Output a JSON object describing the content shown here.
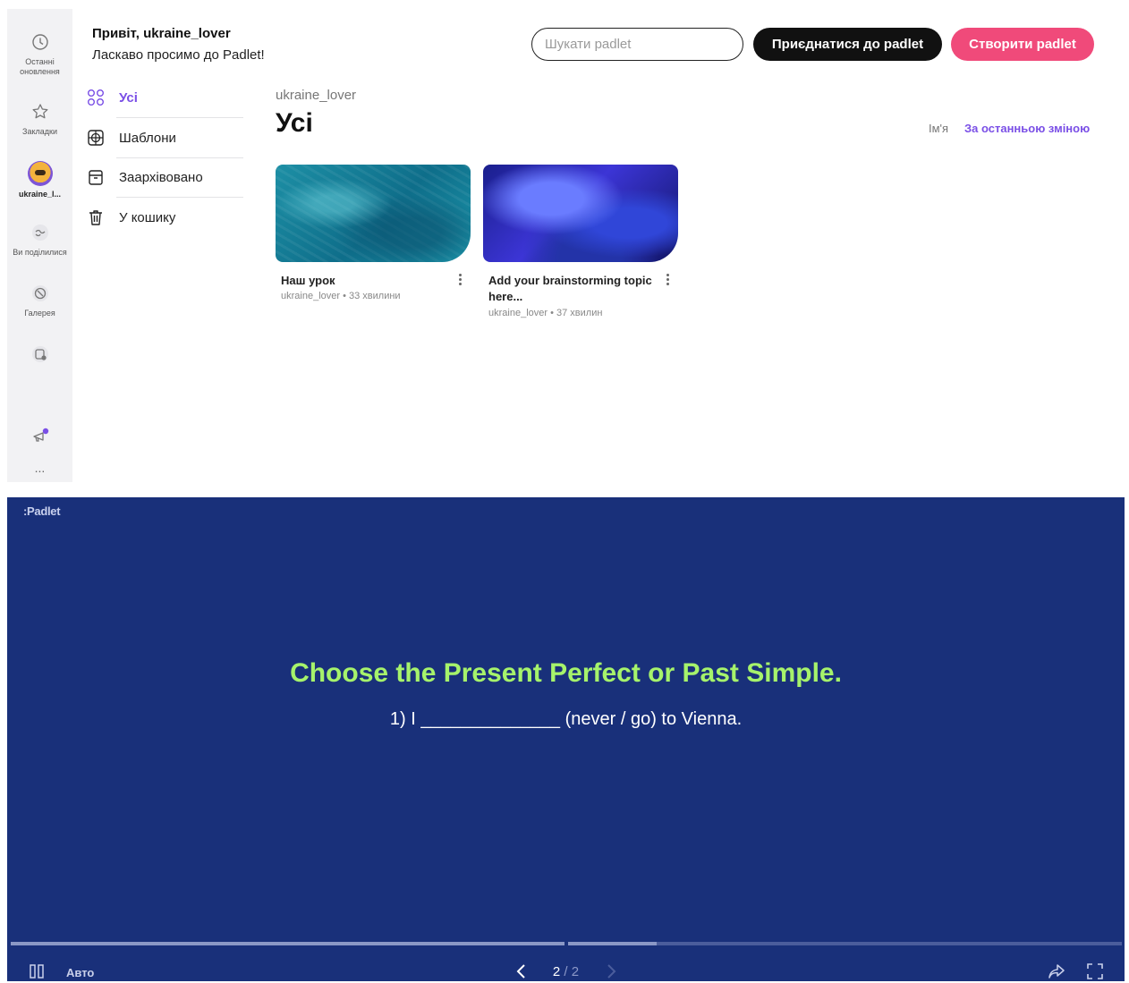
{
  "rail": {
    "items": [
      {
        "label": "Останні оновлення",
        "icon": "clock-icon"
      },
      {
        "label": "Закладки",
        "icon": "star-icon"
      },
      {
        "label": "ukraine_l...",
        "icon": "avatar"
      },
      {
        "label": "Ви поділилися",
        "icon": "handshake-icon"
      },
      {
        "label": "Галерея",
        "icon": "gallery-icon"
      },
      {
        "label": "",
        "icon": "add-board-icon"
      }
    ],
    "more": "..."
  },
  "header": {
    "greeting": "Привіт, ukraine_lover",
    "welcome": "Ласкаво просимо до Padlet!",
    "search_placeholder": "Шукати padlet",
    "join_label": "Приєднатися до padlet",
    "create_label": "Створити padlet"
  },
  "sidenav": {
    "items": [
      {
        "label": "Усі",
        "icon": "grid-circles-icon",
        "active": true
      },
      {
        "label": "Шаблони",
        "icon": "templates-icon",
        "active": false
      },
      {
        "label": "Заархівовано",
        "icon": "archive-icon",
        "active": false
      },
      {
        "label": "У кошику",
        "icon": "trash-icon",
        "active": false
      }
    ]
  },
  "main": {
    "breadcrumb": "ukraine_lover",
    "title": "Усі",
    "sort": {
      "name": "Ім'я",
      "recent": "За останньою зміною"
    },
    "cards": [
      {
        "title": "Наш урок",
        "meta": "ukraine_lover • 33 хвилини"
      },
      {
        "title": "Add your brainstorming topic here...",
        "meta": "ukraine_lover • 37 хвилин"
      }
    ]
  },
  "slideshow": {
    "brand": ":Padlet",
    "title": "Choose the Present Perfect or Past Simple.",
    "text": "1) I ______________ (never / go) to Vienna.",
    "auto_label": "Авто",
    "current_page": "2",
    "total_pages": "/ 2",
    "progress_segment_1": 1.0,
    "progress_segment_2": 0.16
  },
  "colors": {
    "accent_purple": "#7a4fe6",
    "create_pink": "#f04a7a",
    "slide_bg": "#19307a",
    "slide_title": "#a6f36b"
  }
}
